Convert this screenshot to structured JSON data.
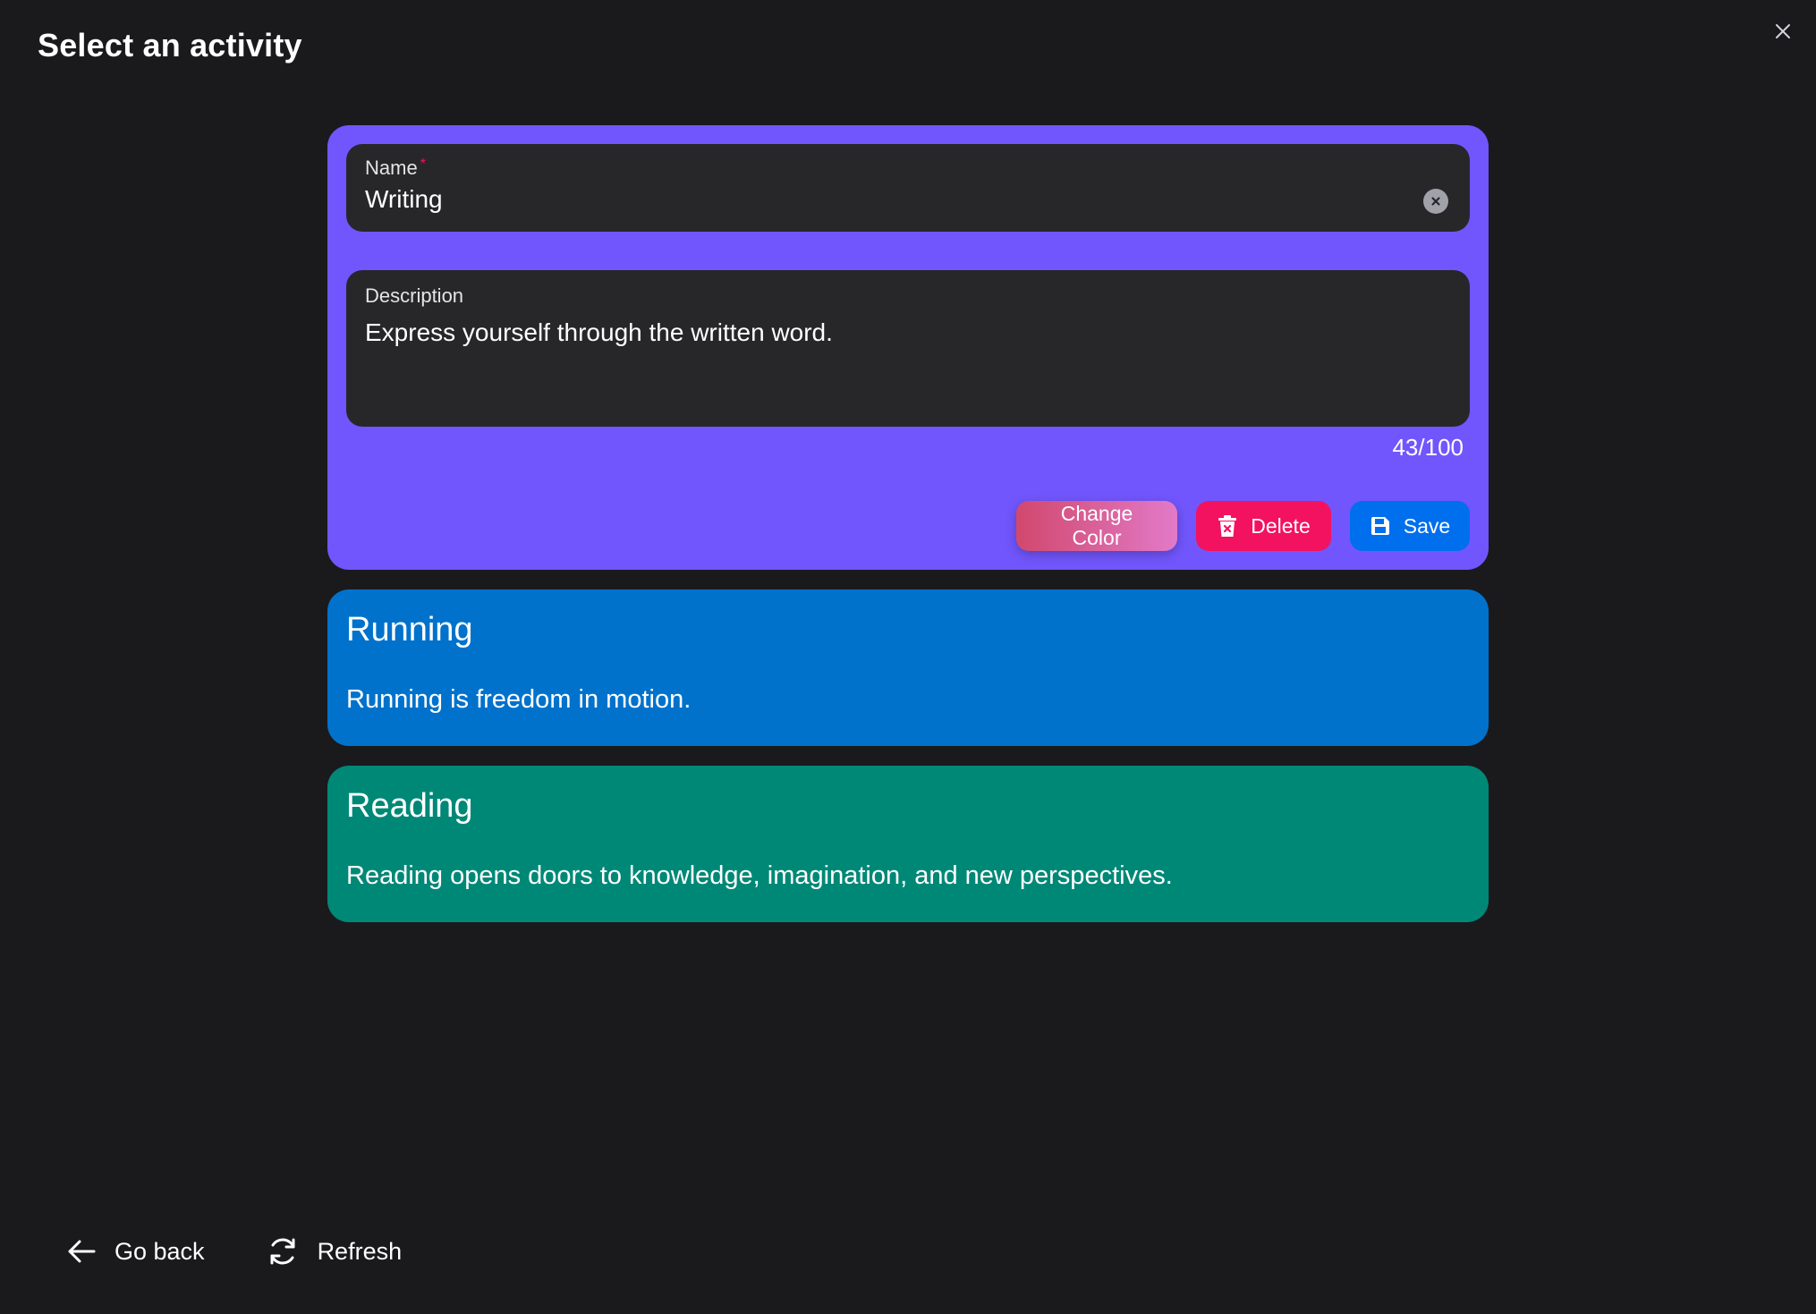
{
  "header": {
    "title": "Select an activity"
  },
  "edit_card": {
    "color": "#7156fd",
    "name_label": "Name",
    "name_required_mark": "*",
    "name_value": "Writing",
    "description_label": "Description",
    "description_value": "Express yourself through the written word.",
    "char_counter": "43/100",
    "buttons": {
      "change_color": "Change Color",
      "delete": "Delete",
      "save": "Save"
    }
  },
  "activities": [
    {
      "title": "Running",
      "description": "Running is freedom in motion.",
      "color": "#0072cc"
    },
    {
      "title": "Reading",
      "description": "Reading opens doors to knowledge, imagination, and new perspectives.",
      "color": "#008877"
    }
  ],
  "footer": {
    "go_back": "Go back",
    "refresh": "Refresh"
  },
  "icons": {
    "close": "close-icon",
    "clear": "clear-icon",
    "delete": "trash-icon",
    "save": "floppy-disk-icon",
    "back": "arrow-left-icon",
    "refresh": "refresh-icon"
  }
}
